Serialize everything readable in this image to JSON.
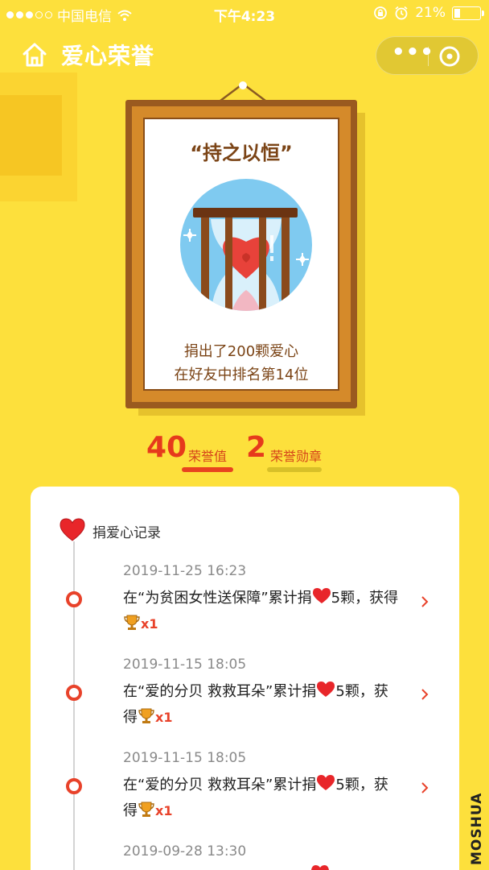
{
  "status_bar": {
    "carrier": "中国电信",
    "time": "下午4:23",
    "battery": "21%",
    "battery_level": 0.21
  },
  "header": {
    "title": "爱心荣誉",
    "home_icon": "home-icon",
    "more_icon": "more-dots-icon",
    "close_icon": "close-target-icon",
    "more_label": "•••"
  },
  "badge": {
    "title": "“持之以恒”",
    "line1": "捐出了200颗爱心",
    "line2": "在好友中排名第14位",
    "image_icon": "hourglass-heart-icon"
  },
  "stats": {
    "honor_value": "40",
    "honor_label": "荣誉值",
    "medal_value": "2",
    "medal_label": "荣誉勋章"
  },
  "records": {
    "title": "捐爱心记录",
    "items": [
      {
        "time": "2019-11-25 16:23",
        "prefix": "在“为贫困女性送保障”累计捐",
        "count": "5颗，获得",
        "suffix": "",
        "reward": "x1"
      },
      {
        "time": "2019-11-15 18:05",
        "prefix": "在“爱的分贝 救救耳朵”累计捐",
        "count": "5颗，获",
        "suffix": "得",
        "reward": "x1"
      },
      {
        "time": "2019-11-15 18:05",
        "prefix": "在“爱的分贝 救救耳朵”累计捐",
        "count": "5颗，获",
        "suffix": "得",
        "reward": "x1"
      },
      {
        "time": "2019-09-28 13:30",
        "prefix": "",
        "count": "",
        "suffix": "",
        "reward": ""
      }
    ]
  },
  "colors": {
    "background": "#fde03c",
    "accent_red": "#e8422a",
    "frame_brown": "#9a5a1f"
  },
  "watermark": "MOSHUA"
}
